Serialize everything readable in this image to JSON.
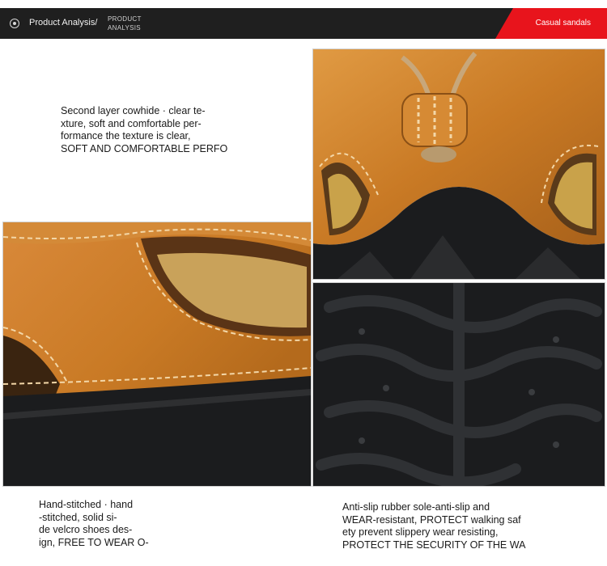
{
  "header": {
    "section_title": "Product Analysis/",
    "subtitle_line1": "PRODUCT",
    "subtitle_line2": "ANALYSIS",
    "badge": "Casual sandals"
  },
  "texts": {
    "upper": "Second layer cowhide · clear te-\nxture, soft and comfortable per-\nformance the texture is clear,\nSOFT AND COMFORTABLE PERFO",
    "stitch": "Hand-stitched · hand\n-stitched, solid si-\nde velcro shoes des-\nign, FREE TO WEAR O-\nFF",
    "sole": "Anti-slip rubber sole-anti-slip and\nWEAR-resistant, PROTECT walking saf\nety prevent slippery wear resisting,\nPROTECT THE SECURITY OF THE WA"
  },
  "colors": {
    "header_bg": "#1f1f1f",
    "badge_red": "#e8141c",
    "leather": "#c97a25",
    "sole": "#1b1c1e"
  }
}
